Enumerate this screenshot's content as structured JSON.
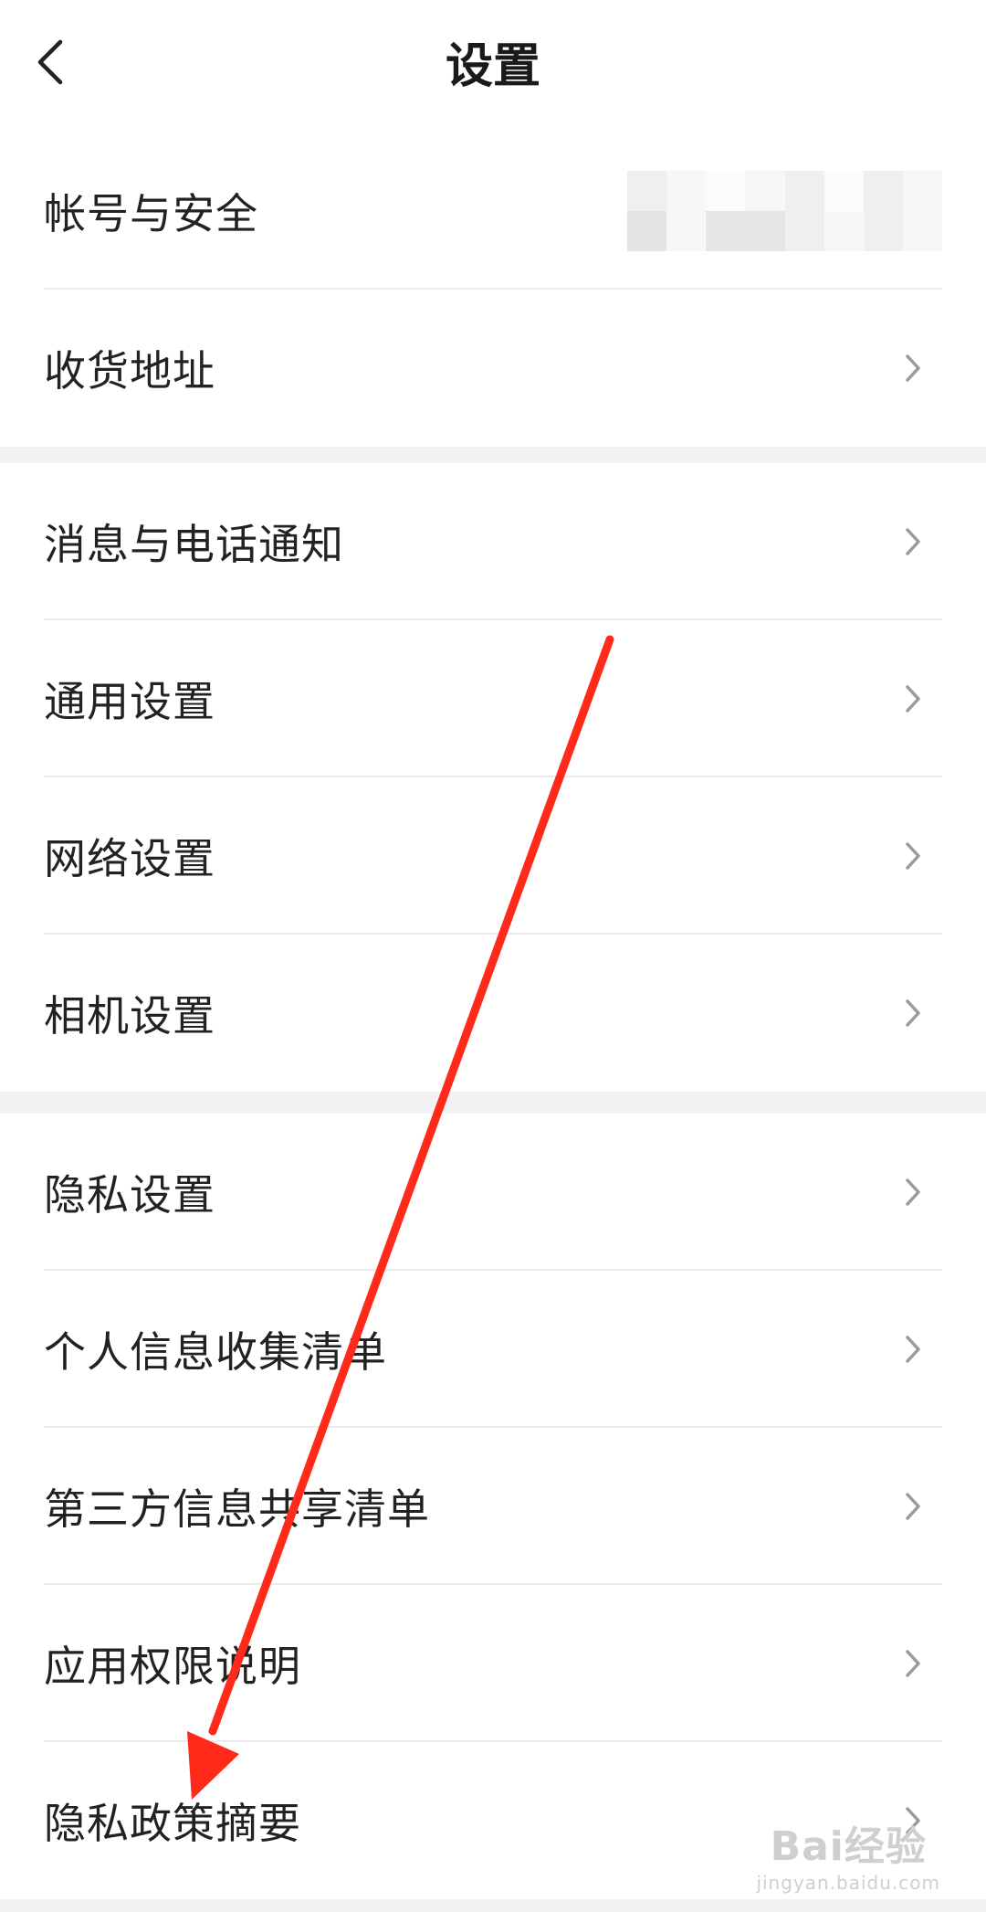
{
  "header": {
    "title": "设置",
    "back_icon": "chevron-left-icon"
  },
  "groups": [
    {
      "items": [
        {
          "label": "帐号与安全",
          "has_masked_value": true
        },
        {
          "label": "收货地址"
        }
      ]
    },
    {
      "items": [
        {
          "label": "消息与电话通知"
        },
        {
          "label": "通用设置"
        },
        {
          "label": "网络设置"
        },
        {
          "label": "相机设置"
        }
      ]
    },
    {
      "items": [
        {
          "label": "隐私设置"
        },
        {
          "label": "个人信息收集清单"
        },
        {
          "label": "第三方信息共享清单"
        },
        {
          "label": "应用权限说明"
        },
        {
          "label": "隐私政策摘要"
        }
      ]
    }
  ],
  "annotation": {
    "color": "#ff2a1a",
    "icon": "red-arrow-annotation"
  },
  "watermark": {
    "brand": "Bai经验",
    "url": "jingyan.baidu.com"
  },
  "colors": {
    "background": "#ffffff",
    "separator": "#f2f2f2",
    "text": "#222222",
    "chevron": "#9a9a9a"
  }
}
